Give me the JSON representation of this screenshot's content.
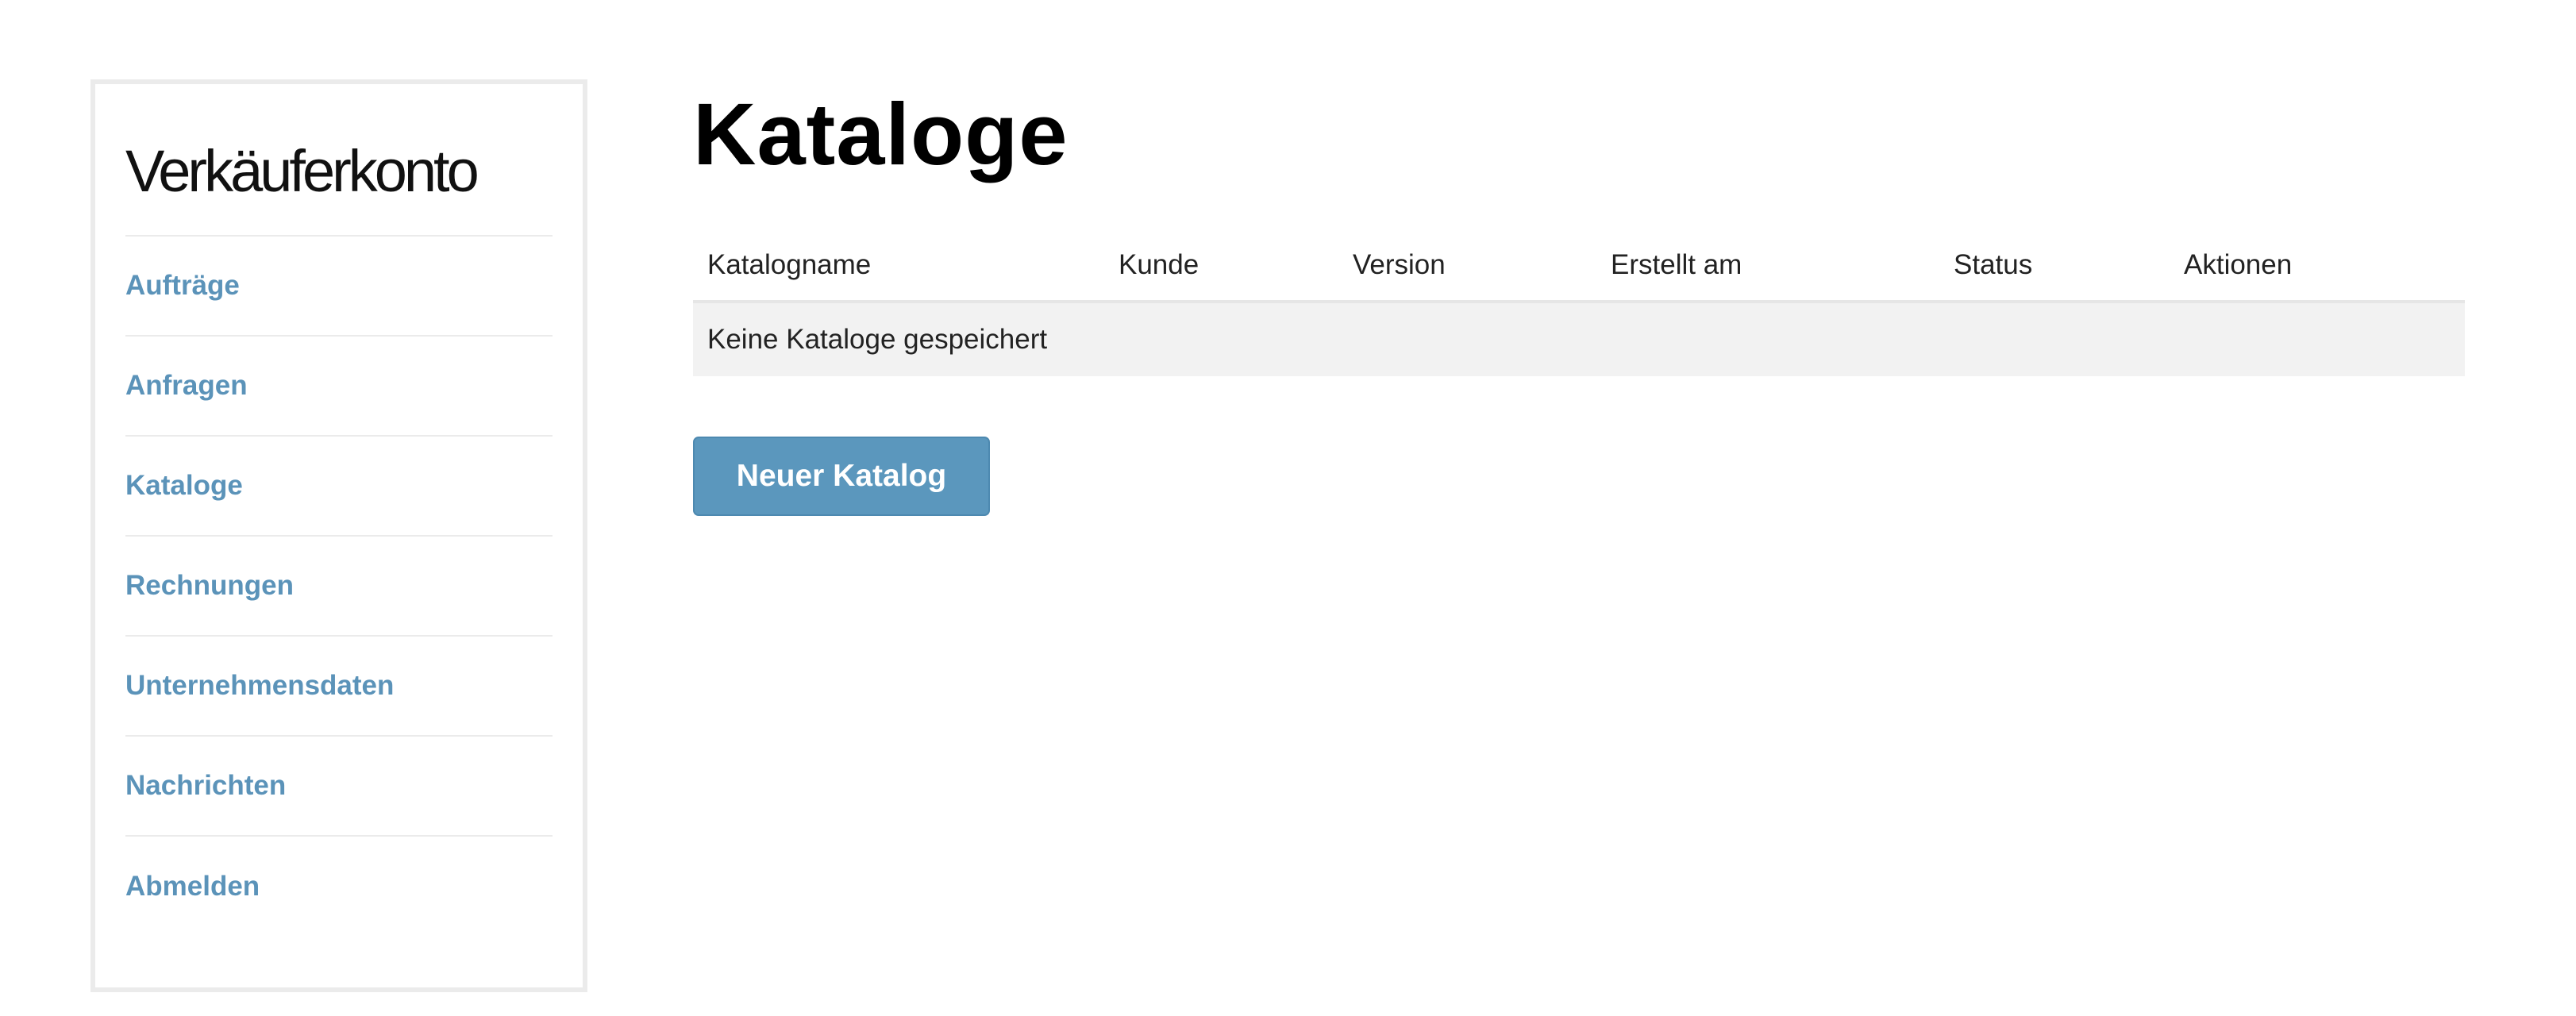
{
  "sidebar": {
    "title": "Verkäuferkonto",
    "items": [
      {
        "label": "Aufträge"
      },
      {
        "label": "Anfragen"
      },
      {
        "label": "Kataloge"
      },
      {
        "label": "Rechnungen"
      },
      {
        "label": "Unternehmensdaten"
      },
      {
        "label": "Nachrichten"
      },
      {
        "label": "Abmelden"
      }
    ]
  },
  "main": {
    "title": "Kataloge",
    "table": {
      "columns": [
        "Katalogname",
        "Kunde",
        "Version",
        "Erstellt am",
        "Status",
        "Aktionen"
      ],
      "empty_message": "Keine Kataloge gespeichert"
    },
    "new_button_label": "Neuer Katalog"
  },
  "colors": {
    "link": "#5b93b9",
    "button": "#5b97bd",
    "border": "#ebebeb",
    "row_background": "#f2f2f2"
  }
}
